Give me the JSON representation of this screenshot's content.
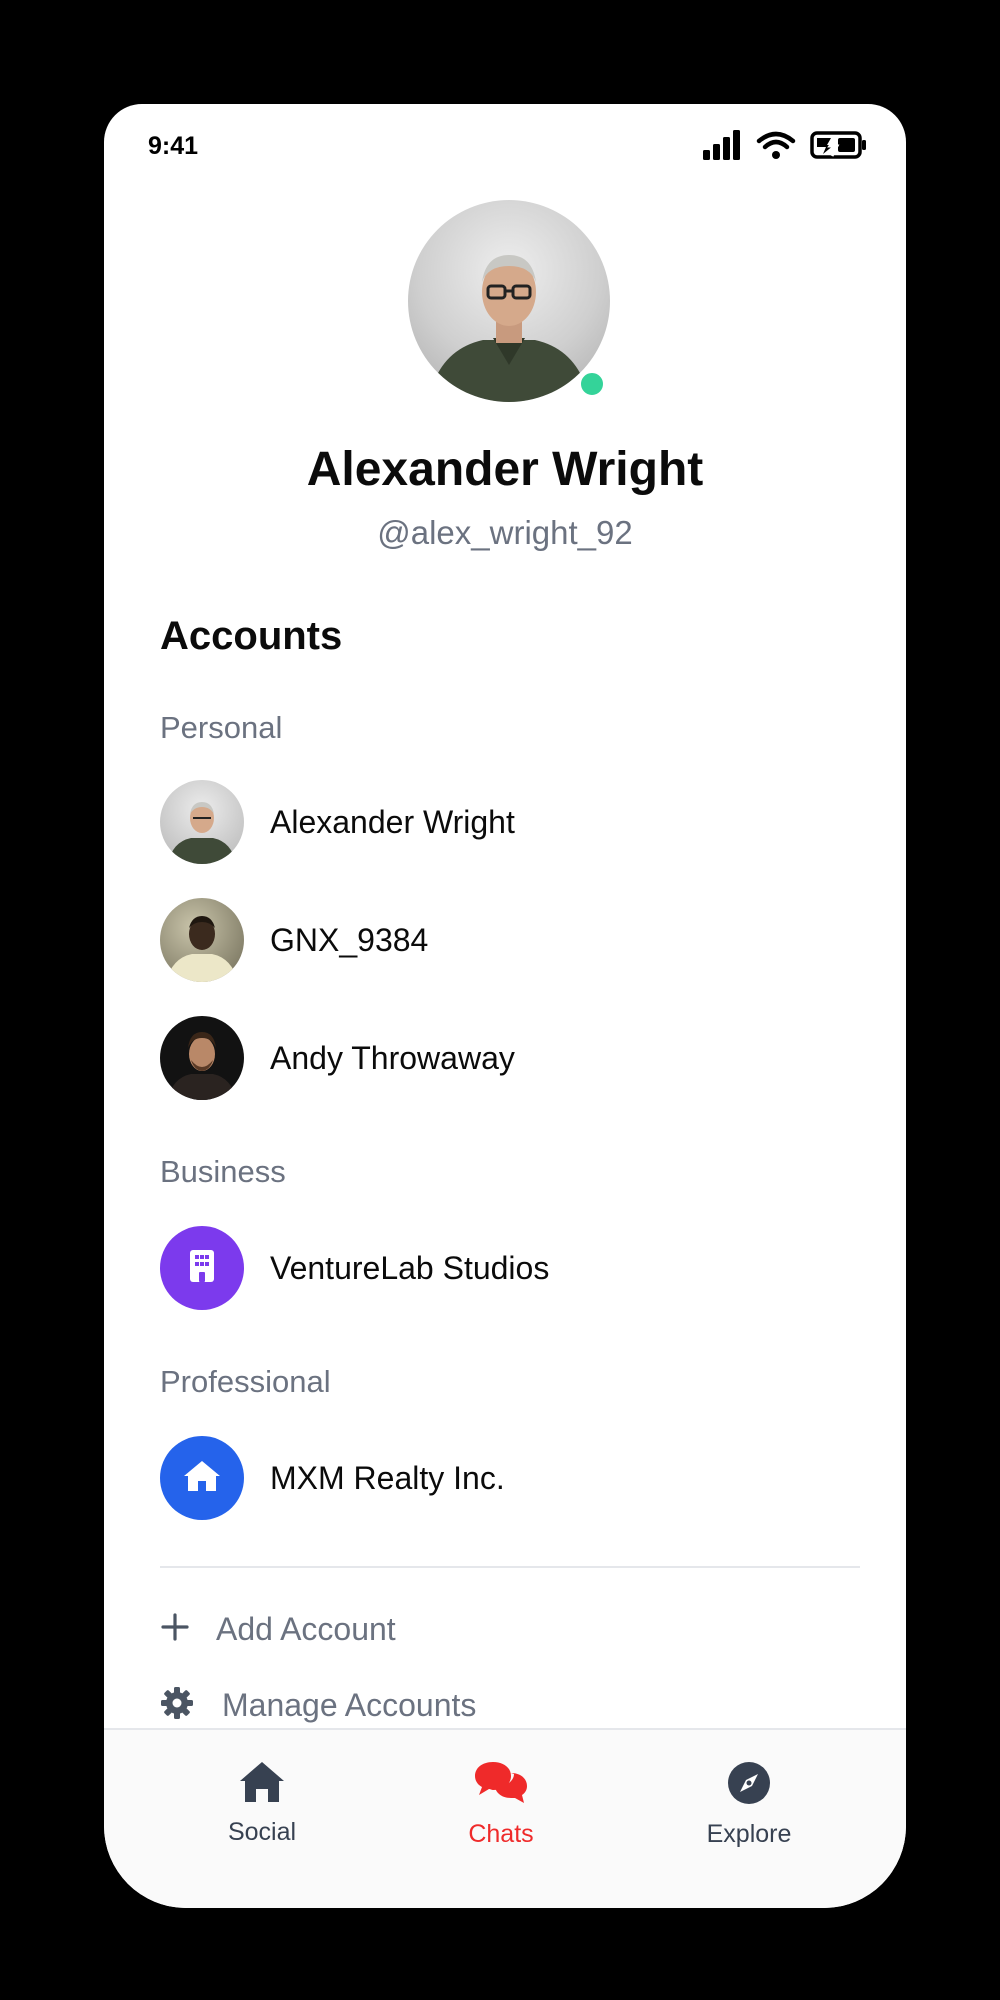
{
  "status_bar": {
    "time": "9:41",
    "icons": [
      "signal-icon",
      "wifi-icon",
      "battery-charging-icon"
    ]
  },
  "profile": {
    "name": "Alexander Wright",
    "handle": "@alex_wright_92",
    "online": true,
    "online_color": "#34d399"
  },
  "accounts": {
    "heading": "Accounts",
    "groups": [
      {
        "label": "Personal",
        "items": [
          {
            "name": "Alexander Wright",
            "avatar": "photo"
          },
          {
            "name": "GNX_9384",
            "avatar": "photo"
          },
          {
            "name": "Andy Throwaway",
            "avatar": "photo"
          }
        ]
      },
      {
        "label": "Business",
        "items": [
          {
            "name": "VentureLab Studios",
            "avatar": "building-icon",
            "color": "#7c3aed"
          }
        ]
      },
      {
        "label": "Professional",
        "items": [
          {
            "name": "MXM Realty Inc.",
            "avatar": "house-icon",
            "color": "#2563eb"
          }
        ]
      }
    ]
  },
  "actions": {
    "add_account": "Add Account",
    "manage_accounts": "Manage Accounts"
  },
  "tabs": [
    {
      "label": "Social",
      "icon": "house-icon",
      "active": false
    },
    {
      "label": "Chats",
      "icon": "chat-bubbles-icon",
      "active": true
    },
    {
      "label": "Explore",
      "icon": "compass-icon",
      "active": false
    }
  ],
  "colors": {
    "active_tab": "#ef2a2a",
    "inactive_tab": "#374151",
    "secondary_text": "#6b7280"
  }
}
